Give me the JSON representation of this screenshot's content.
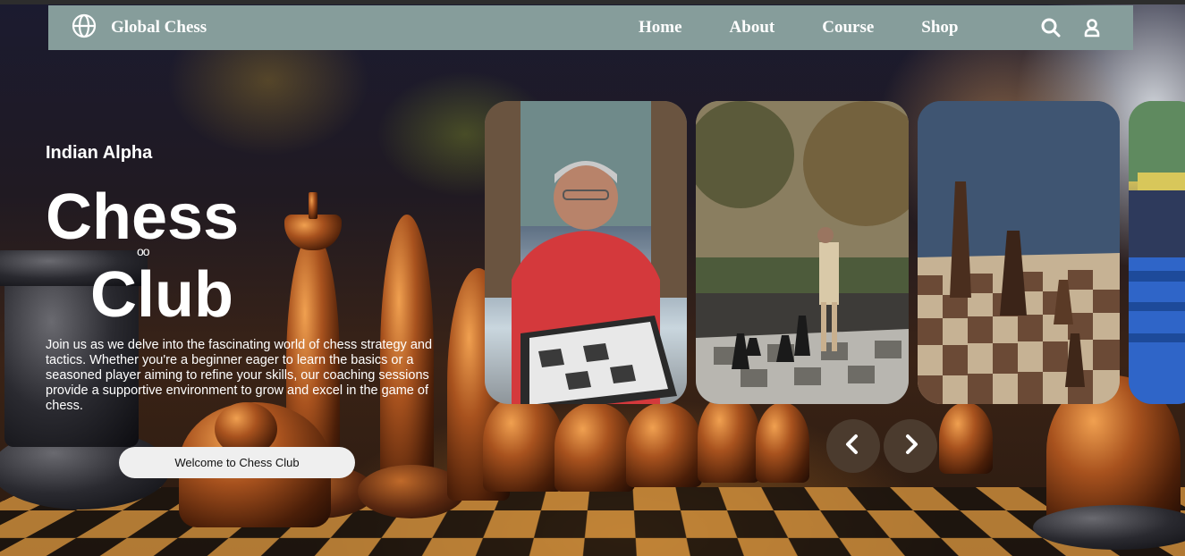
{
  "navbar": {
    "brand_icon": "globe-icon",
    "brand_name": "Global Chess",
    "links": [
      {
        "label": "Home"
      },
      {
        "label": "About"
      },
      {
        "label": "Course"
      },
      {
        "label": "Shop"
      }
    ],
    "search_icon": "search-icon",
    "user_icon": "user-icon",
    "background": "#869d9b"
  },
  "hero": {
    "kicker": "Indian Alpha",
    "title_line1": "Chess",
    "title_line2": "Club",
    "title_ornament": "oo",
    "description": "Join us as we delve into the fascinating world of chess strategy and tactics. Whether you're a beginner eager to learn the basics or a seasoned player aiming to refine your skills, our coaching sessions provide a supportive environment to grow and excel in the game of chess.",
    "cta_label": "Welcome to Chess Club"
  },
  "carousel": {
    "slides": [
      {
        "subject": "older man playing chess at a table"
      },
      {
        "subject": "man playing giant outdoor chess in a park"
      },
      {
        "subject": "close-up of wooden chess pieces on board"
      },
      {
        "subject": "people seated on blue chairs outdoors"
      }
    ],
    "prev_icon": "chevron-left-icon",
    "next_icon": "chevron-right-icon",
    "arrow_color": "#4b3b2e"
  }
}
